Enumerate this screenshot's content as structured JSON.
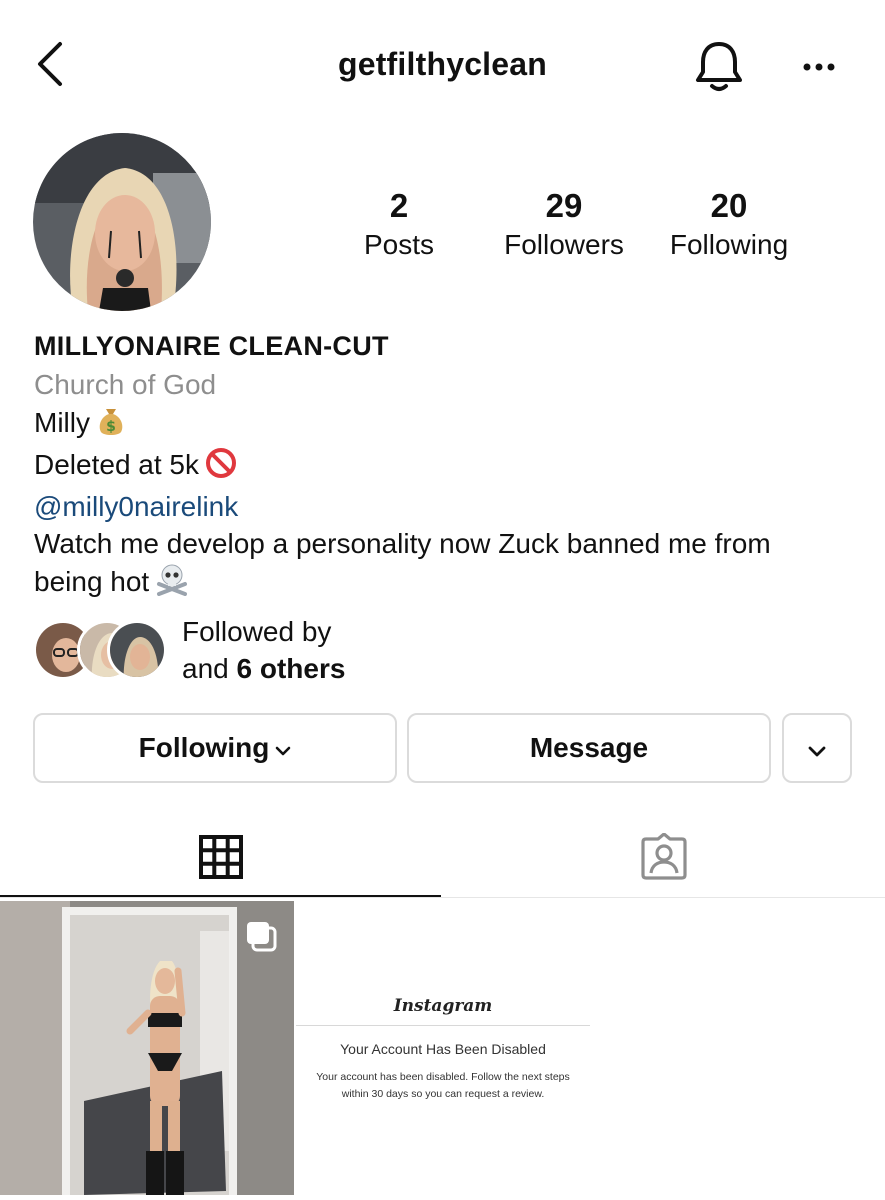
{
  "header": {
    "username": "getfilthyclean",
    "back_icon": "chevron-left-icon",
    "bell_icon": "bell-icon",
    "more_icon": "more-horizontal-icon"
  },
  "stats": {
    "posts": {
      "value": "2",
      "label": "Posts"
    },
    "followers": {
      "value": "29",
      "label": "Followers"
    },
    "following": {
      "value": "20",
      "label": "Following"
    }
  },
  "bio": {
    "name": "MILLYONAIRE CLEAN-CUT",
    "category": "Church of God",
    "line1": "Milly",
    "line1_emoji": "money-bag-icon",
    "line2": "Deleted at 5k",
    "line2_emoji": "prohibited-icon",
    "link": "@milly0nairelink",
    "line4a": "Watch me develop a personality now Zuck banned me from",
    "line4b": "being hot",
    "line4_emoji": "skull-crossbones-icon"
  },
  "followed_by": {
    "label": "Followed by",
    "and_text": "and",
    "others": "6 others"
  },
  "buttons": {
    "following": "Following",
    "message": "Message"
  },
  "tabs": [
    {
      "name": "grid",
      "icon": "grid-icon",
      "active": true
    },
    {
      "name": "tagged",
      "icon": "tagged-person-icon",
      "active": false
    }
  ],
  "posts": {
    "disabled_notice": {
      "logo": "Instagram",
      "heading": "Your Account Has Been Disabled",
      "body": "Your account has been disabled. Follow the next steps within 30 days so you can request a review."
    }
  },
  "colors": {
    "link": "#1a4a7a",
    "muted": "#8e8e8e",
    "border": "#dbdbdb"
  }
}
